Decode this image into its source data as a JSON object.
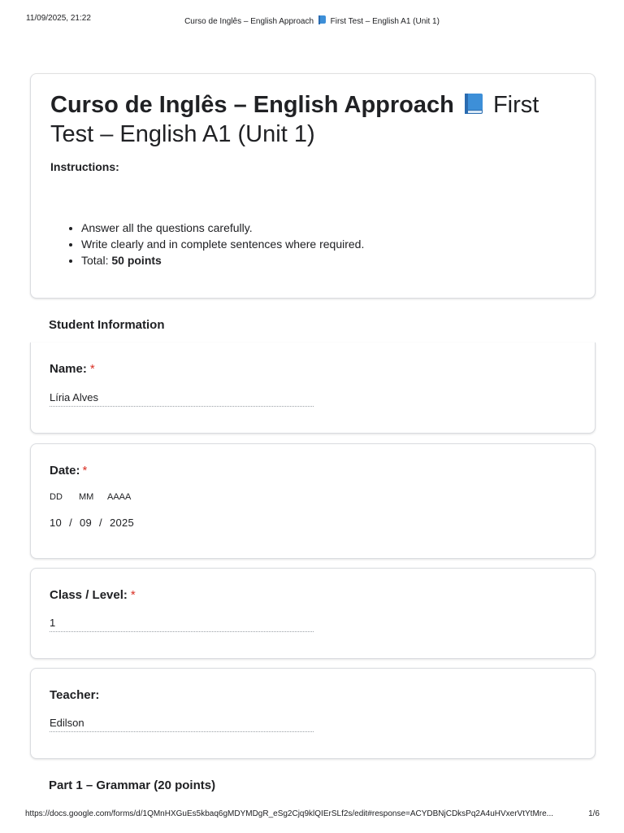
{
  "print_header": {
    "timestamp": "11/09/2025, 21:22",
    "title_part1": "Curso de Inglês – English Approach",
    "title_part2": "First Test – English A1 (Unit 1)"
  },
  "form": {
    "title_bold": "Curso de Inglês – English Approach",
    "title_rest_line1": "First",
    "title_rest_line2": "Test – English A1 (Unit 1)",
    "instructions_label": "Instructions:",
    "instructions": [
      "Answer all the questions carefully.",
      "Write clearly and in complete sentences where required.",
      "Total: "
    ],
    "total_points": "50 points"
  },
  "sections": {
    "student_info": "Student Information",
    "part1": "Part 1 – Grammar (20 points)"
  },
  "questions": {
    "name": {
      "label": "Name:",
      "required_mark": "*",
      "answer": "Líria Alves"
    },
    "date": {
      "label": "Date:",
      "required_mark": "*",
      "day_label": "DD",
      "month_label": "MM",
      "year_label": "AAAA",
      "day": "10",
      "month": "09",
      "year": "2025",
      "separator": "/"
    },
    "class_level": {
      "label": "Class / Level:",
      "required_mark": "*",
      "answer": "1"
    },
    "teacher": {
      "label": "Teacher:",
      "answer": "Edilson"
    }
  },
  "print_footer": {
    "url": "https://docs.google.com/forms/d/1QMnHXGuEs5kbaq6gMDYMDgR_eSg2Cjq9klQIErSLf2s/edit#response=ACYDBNjCDksPq2A4uHVxerVtYtMre...",
    "page": "1/6"
  },
  "icons": {
    "title_icon": "blue-book-icon"
  }
}
